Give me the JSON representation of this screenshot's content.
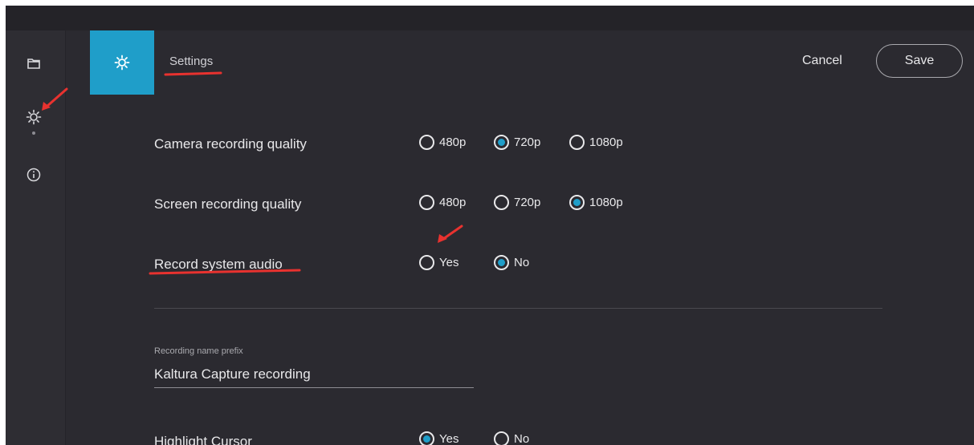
{
  "header": {
    "title": "Settings",
    "cancel_label": "Cancel",
    "save_label": "Save"
  },
  "sidebar": {
    "items": [
      {
        "icon": "folder-icon"
      },
      {
        "icon": "gear-icon",
        "active": true
      },
      {
        "icon": "info-icon"
      }
    ]
  },
  "settings": {
    "camera_quality": {
      "label": "Camera recording quality",
      "options": [
        "480p",
        "720p",
        "1080p"
      ],
      "selected": "720p"
    },
    "screen_quality": {
      "label": "Screen recording quality",
      "options": [
        "480p",
        "720p",
        "1080p"
      ],
      "selected": "1080p"
    },
    "system_audio": {
      "label": "Record system audio",
      "options": [
        "Yes",
        "No"
      ],
      "selected": "No"
    },
    "name_prefix": {
      "caption": "Recording name prefix",
      "value": "Kaltura Capture recording"
    },
    "highlight_cursor": {
      "label": "Highlight Cursor",
      "options": [
        "Yes",
        "No"
      ],
      "selected": "Yes"
    }
  },
  "colors": {
    "accent": "#1f9ec9",
    "background": "#2b2a30",
    "sidebar": "#2e2d33",
    "annotation": "#e8322f"
  }
}
